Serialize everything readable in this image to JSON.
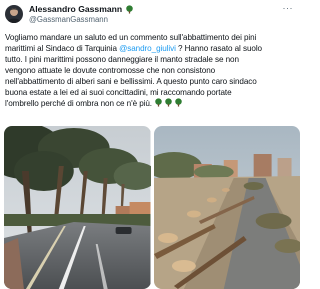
{
  "author": {
    "name": "Alessandro Gassmann",
    "handle": "@GassmanGassmann",
    "name_emoji": "tree-emoji"
  },
  "more_label": "···",
  "tweet": {
    "line1": "Vogliamo mandare un saluto ed un commento sull'abbattimento dei pini",
    "line2_a": "marittimi al Sindaco di Tarquinia ",
    "mention": "@sandro_giulivi",
    "line2_b": " ? Hanno rasato al suolo",
    "line3": "tutto. I pini marittimi possono danneggiare il manto stradale se non",
    "line4": "vengono attuate le dovute contromosse che non consistono",
    "line5": "nell'abbattimento di alberi sani e bellissimi. A questo punto caro sindaco",
    "line6": "buona estate a lei ed ai suoi concittadini, mi raccomando portate",
    "line7": "l'ombrello perché di ombra non ce n'è più. ",
    "trailing_emoji": [
      "tree-emoji",
      "tree-emoji",
      "tree-emoji"
    ]
  },
  "media": [
    {
      "name": "photo-before",
      "depicts": "road lined with maritime pines"
    },
    {
      "name": "photo-after",
      "depicts": "road with felled pines and stumps"
    }
  ],
  "colors": {
    "text": "#0f1419",
    "secondary": "#536471",
    "link": "#1d9bf0",
    "tree_green": "#2f7d32"
  }
}
